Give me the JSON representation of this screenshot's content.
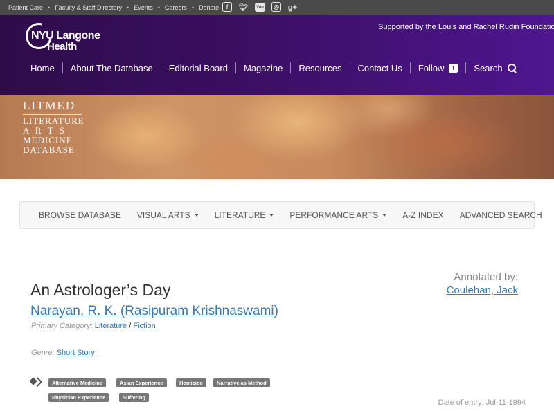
{
  "topbar": {
    "links": [
      "Patient Care",
      "Faculty & Staff Directory",
      "Events",
      "Careers",
      "Donate"
    ],
    "social_icons": [
      "facebook-icon",
      "twitter-icon",
      "youtube-icon",
      "instagram-icon",
      "google-plus-icon"
    ]
  },
  "header": {
    "logo_line1": "NYU Langone",
    "logo_line2": "Health",
    "supported": "Supported by the Louis and Rachel Rudin Foundation",
    "nav": {
      "home": "Home",
      "about": "About The Database",
      "editorial": "Editorial Board",
      "magazine": "Magazine",
      "resources": "Resources",
      "contact": "Contact Us",
      "follow": "Follow",
      "search": "Search"
    }
  },
  "banner": {
    "litmed": "LITMED",
    "line1": "LITERATURE",
    "line2": "A R T S",
    "line3": "MEDICINE",
    "line4": "DATABASE"
  },
  "subnav": {
    "browse": "BROWSE DATABASE",
    "visual": "VISUAL ARTS",
    "literature": "LITERATURE",
    "performance": "PERFORMANCE ARTS",
    "az": "A-Z INDEX",
    "advanced": "ADVANCED SEARCH"
  },
  "entry": {
    "annotated_label": "Annotated by:",
    "annotated_name": "Coulehan, Jack",
    "title": "An Astrologer’s Day",
    "author": "Narayan, R. K. (Rasipuram Krishnaswami)",
    "primary_label": "Primary Category:",
    "primary_cat1": "Literature",
    "primary_sep": " / ",
    "primary_cat2": "Fiction",
    "genre_label": "Genre:",
    "genre_value": "Short Story",
    "tags": [
      "Alternative Medicine",
      "Asian Experience",
      "Homicide",
      "Narrative as Method",
      "Physician Experience",
      "Suffering"
    ],
    "date_entry": "Date of entry: Jul-11-1994"
  },
  "colors": {
    "header_purple": "#3b0f63",
    "link_blue": "#337ab7",
    "topbar_gray": "#4a4a4a",
    "tag_gray": "#777777"
  }
}
